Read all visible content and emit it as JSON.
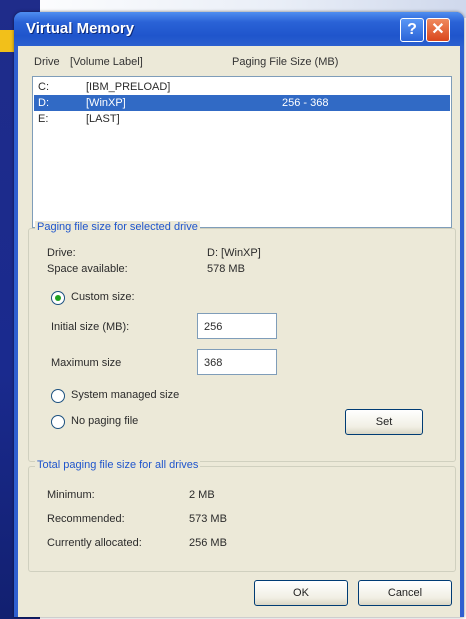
{
  "window": {
    "title": "Virtual Memory",
    "help_glyph": "?",
    "close_glyph": "✕"
  },
  "list": {
    "headers": {
      "drive": "Drive",
      "volume": "[Volume Label]",
      "paging": "Paging File Size (MB)"
    },
    "rows": [
      {
        "drive": "C:",
        "volume": "[IBM_PRELOAD]",
        "paging": ""
      },
      {
        "drive": "D:",
        "volume": "[WinXP]",
        "paging": "256 - 368"
      },
      {
        "drive": "E:",
        "volume": "[LAST]",
        "paging": ""
      }
    ]
  },
  "selected": {
    "group_title": "Paging file size for selected drive",
    "drive_label": "Drive:",
    "drive_value": "D:  [WinXP]",
    "space_label": "Space available:",
    "space_value": "578 MB",
    "custom_label": "Custom size:",
    "initial_label": "Initial size (MB):",
    "initial_value": "256",
    "maximum_label": "Maximum size",
    "maximum_value": "368",
    "system_label": "System managed size",
    "nopaging_label": "No paging file",
    "set_label": "Set"
  },
  "total": {
    "group_title": "Total paging file size for all drives",
    "minimum_label": "Minimum:",
    "minimum_value": "2 MB",
    "recommended_label": "Recommended:",
    "recommended_value": "573 MB",
    "allocated_label": "Currently allocated:",
    "allocated_value": "256 MB"
  },
  "buttons": {
    "ok": "OK",
    "cancel": "Cancel"
  }
}
